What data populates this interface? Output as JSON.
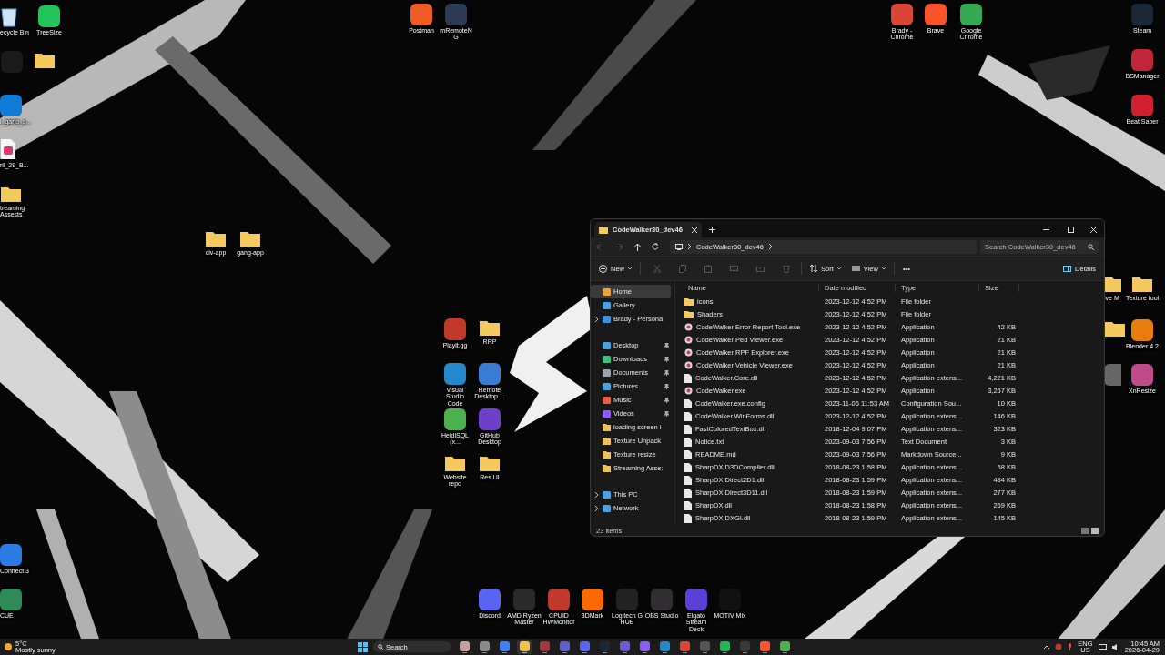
{
  "desktop_icons": [
    {
      "label": "ecycle Bin",
      "kind": "bin"
    },
    {
      "label": "TreeSize",
      "kind": "app",
      "color": "#22c35a"
    },
    {
      "kind": "app",
      "color": "#1a1a1a"
    },
    {
      "kind": "folder"
    },
    {
      "label": "Postman",
      "kind": "app",
      "color": "#ef5b25"
    },
    {
      "label": "mRemoteNG",
      "kind": "app",
      "color": "#2b3a55"
    },
    {
      "label": "Brady - Chrome",
      "kind": "app",
      "color": "#db4437"
    },
    {
      "label": "Brave",
      "kind": "app",
      "color": "#fb542b"
    },
    {
      "label": "Google Chrome",
      "kind": "app",
      "color": "#34a853"
    },
    {
      "label": "Steam",
      "kind": "app",
      "color": "#1b2838"
    },
    {
      "label": "l_gang_s...",
      "kind": "app",
      "color": "#0f7bd6"
    },
    {
      "label": "BSManager",
      "kind": "app",
      "color": "#c0253a"
    },
    {
      "label": "Beat Saber",
      "kind": "app",
      "color": "#d02030"
    },
    {
      "label": "ril_29_B...",
      "kind": "file"
    },
    {
      "label": "treaming Assests",
      "kind": "folder"
    },
    {
      "label": "civ-app",
      "kind": "folder"
    },
    {
      "label": "gang-app",
      "kind": "folder"
    },
    {
      "label": "Playit.gg",
      "kind": "app",
      "color": "#c0392b"
    },
    {
      "label": "RRP",
      "kind": "folder"
    },
    {
      "label": "Visual Studio Code",
      "kind": "app",
      "color": "#2489ca"
    },
    {
      "label": "Remote Desktop ...",
      "kind": "app",
      "color": "#3a7bd5"
    },
    {
      "label": "ive M",
      "kind": "folder"
    },
    {
      "label": "Texture tool",
      "kind": "folder"
    },
    {
      "label": "HeidiSQL (x...",
      "kind": "app",
      "color": "#4caf50"
    },
    {
      "label": "GitHub Desktop",
      "kind": "app",
      "color": "#6e40c9"
    },
    {
      "kind": "folder"
    },
    {
      "label": "Blender 4.2",
      "kind": "app",
      "color": "#e87d0d"
    },
    {
      "kind": "app",
      "color": "#666666"
    },
    {
      "label": "XnResize",
      "kind": "app",
      "color": "#c04a8a"
    },
    {
      "label": "Website repo",
      "kind": "folder"
    },
    {
      "label": "Res UI",
      "kind": "folder"
    },
    {
      "label": "Connect 3",
      "kind": "app",
      "color": "#2c7be5"
    },
    {
      "label": "CUE",
      "kind": "app",
      "color": "#2e8b57"
    },
    {
      "label": "Discord",
      "kind": "app",
      "color": "#5865f2"
    },
    {
      "label": "AMD Ryzen Master",
      "kind": "app",
      "color": "#2a2a2a"
    },
    {
      "label": "CPUID HWMonitor",
      "kind": "app",
      "color": "#c0392b"
    },
    {
      "label": "3DMark",
      "kind": "app",
      "color": "#ff6a00"
    },
    {
      "label": "Logitech G HUB",
      "kind": "app",
      "color": "#222222"
    },
    {
      "label": "OBS Studio",
      "kind": "app",
      "color": "#302e31"
    },
    {
      "label": "Elgato Stream Deck",
      "kind": "app",
      "color": "#5b3fd6"
    },
    {
      "label": "MOTIV Mix",
      "kind": "app",
      "color": "#111111"
    }
  ],
  "explorer": {
    "tab_title": "CodeWalker30_dev46",
    "path": "CodeWalker30_dev46",
    "search": {
      "placeholder": "Search CodeWalker30_dev46"
    },
    "toolbar": {
      "new": "New",
      "sort": "Sort",
      "view": "View",
      "more": "•••",
      "details": "Details"
    },
    "nav": [
      {
        "label": "Home",
        "kind": "home",
        "selected": true,
        "pinned": false,
        "expandable": false
      },
      {
        "label": "Gallery",
        "kind": "gallery",
        "selected": false,
        "pinned": false,
        "expandable": false
      },
      {
        "label": "Brady - Persona",
        "kind": "cloud",
        "selected": false,
        "pinned": false,
        "expandable": true
      },
      {
        "label": "Desktop",
        "kind": "desktop",
        "selected": false,
        "pinned": true,
        "expandable": false
      },
      {
        "label": "Downloads",
        "kind": "downloads",
        "selected": false,
        "pinned": true,
        "expandable": false
      },
      {
        "label": "Documents",
        "kind": "documents",
        "selected": false,
        "pinned": true,
        "expandable": false
      },
      {
        "label": "Pictures",
        "kind": "pictures",
        "selected": false,
        "pinned": true,
        "expandable": false
      },
      {
        "label": "Music",
        "kind": "music",
        "selected": false,
        "pinned": true,
        "expandable": false
      },
      {
        "label": "Videos",
        "kind": "videos",
        "selected": false,
        "pinned": true,
        "expandable": false
      },
      {
        "label": "loading screen i",
        "kind": "folder",
        "selected": false,
        "pinned": false,
        "expandable": false
      },
      {
        "label": "Texture Unpack",
        "kind": "folder",
        "selected": false,
        "pinned": false,
        "expandable": false
      },
      {
        "label": "Texture resize",
        "kind": "folder",
        "selected": false,
        "pinned": false,
        "expandable": false
      },
      {
        "label": "Streaming Asse:",
        "kind": "folder",
        "selected": false,
        "pinned": false,
        "expandable": false
      },
      {
        "label": "This PC",
        "kind": "pc",
        "selected": false,
        "pinned": false,
        "expandable": true
      },
      {
        "label": "Network",
        "kind": "network",
        "selected": false,
        "pinned": false,
        "expandable": true
      }
    ],
    "columns": [
      "Name",
      "Date modified",
      "Type",
      "Size"
    ],
    "rows": [
      {
        "name": "icons",
        "date": "2023-12-12 4:52 PM",
        "type": "File folder",
        "kind": "folder"
      },
      {
        "name": "Shaders",
        "date": "2023-12-12 4:52 PM",
        "type": "File folder",
        "kind": "folder"
      },
      {
        "name": "CodeWalker Error Report Tool.exe",
        "date": "2023-12-12 4:52 PM",
        "type": "Application",
        "size": "42 KB",
        "kind": "app"
      },
      {
        "name": "CodeWalker Ped Viewer.exe",
        "date": "2023-12-12 4:52 PM",
        "type": "Application",
        "size": "21 KB",
        "kind": "app"
      },
      {
        "name": "CodeWalker RPF Explorer.exe",
        "date": "2023-12-12 4:52 PM",
        "type": "Application",
        "size": "21 KB",
        "kind": "app"
      },
      {
        "name": "CodeWalker Vehicle Viewer.exe",
        "date": "2023-12-12 4:52 PM",
        "type": "Application",
        "size": "21 KB",
        "kind": "app"
      },
      {
        "name": "CodeWalker.Core.dll",
        "date": "2023-12-12 4:52 PM",
        "type": "Application extens...",
        "size": "4,221 KB",
        "kind": "file"
      },
      {
        "name": "CodeWalker.exe",
        "date": "2023-12-12 4:52 PM",
        "type": "Application",
        "size": "3,257 KB",
        "kind": "app"
      },
      {
        "name": "CodeWalker.exe.config",
        "date": "2023-11-06 11:53 AM",
        "type": "Configuration Sou...",
        "size": "10 KB",
        "kind": "file"
      },
      {
        "name": "CodeWalker.WinForms.dll",
        "date": "2023-12-12 4:52 PM",
        "type": "Application extens...",
        "size": "146 KB",
        "kind": "file"
      },
      {
        "name": "FastColoredTextBox.dll",
        "date": "2018-12-04 9:07 PM",
        "type": "Application extens...",
        "size": "323 KB",
        "kind": "file"
      },
      {
        "name": "Notice.txt",
        "date": "2023-09-03 7:56 PM",
        "type": "Text Document",
        "size": "3 KB",
        "kind": "file"
      },
      {
        "name": "README.md",
        "date": "2023-09-03 7:56 PM",
        "type": "Markdown Source...",
        "size": "9 KB",
        "kind": "file"
      },
      {
        "name": "SharpDX.D3DCompiler.dll",
        "date": "2018-08-23 1:58 PM",
        "type": "Application extens...",
        "size": "58 KB",
        "kind": "file"
      },
      {
        "name": "SharpDX.Direct2D1.dll",
        "date": "2018-08-23 1:59 PM",
        "type": "Application extens...",
        "size": "484 KB",
        "kind": "file"
      },
      {
        "name": "SharpDX.Direct3D11.dll",
        "date": "2018-08-23 1:59 PM",
        "type": "Application extens...",
        "size": "277 KB",
        "kind": "file"
      },
      {
        "name": "SharpDX.dll",
        "date": "2018-08-23 1:58 PM",
        "type": "Application extens...",
        "size": "269 KB",
        "kind": "file"
      },
      {
        "name": "SharpDX.DXGI.dll",
        "date": "2018-08-23 1:59 PM",
        "type": "Application extens...",
        "size": "145 KB",
        "kind": "file"
      }
    ],
    "status": "23 items"
  },
  "taskbar": {
    "weather": {
      "temp": "5°C",
      "text": "Mostly sunny"
    },
    "search": {
      "placeholder": "Search"
    },
    "apps": [
      {
        "color": "#c9a0a0",
        "selected": false
      },
      {
        "color": "#8a8a8a",
        "selected": false
      },
      {
        "color": "#3b82f6",
        "selected": false
      },
      {
        "color": "#f2c14e",
        "selected": true
      },
      {
        "color": "#a4373a",
        "selected": false
      },
      {
        "color": "#5b5fc7",
        "selected": false
      },
      {
        "color": "#5865f2",
        "selected": false
      },
      {
        "color": "#1b2838",
        "selected": false
      },
      {
        "color": "#6b5bd6",
        "selected": false
      },
      {
        "color": "#8b5cf6",
        "selected": false
      },
      {
        "color": "#2489ca",
        "selected": false
      },
      {
        "color": "#db4437",
        "selected": false
      },
      {
        "color": "#555555",
        "selected": false
      },
      {
        "color": "#1db954",
        "selected": false
      },
      {
        "color": "#3a3a3a",
        "selected": false
      },
      {
        "color": "#fb542b",
        "selected": false
      },
      {
        "color": "#4caf50",
        "selected": false
      }
    ],
    "language": "ENG",
    "region": "US",
    "time": "10:45 AM",
    "date": "2026-04-29"
  }
}
